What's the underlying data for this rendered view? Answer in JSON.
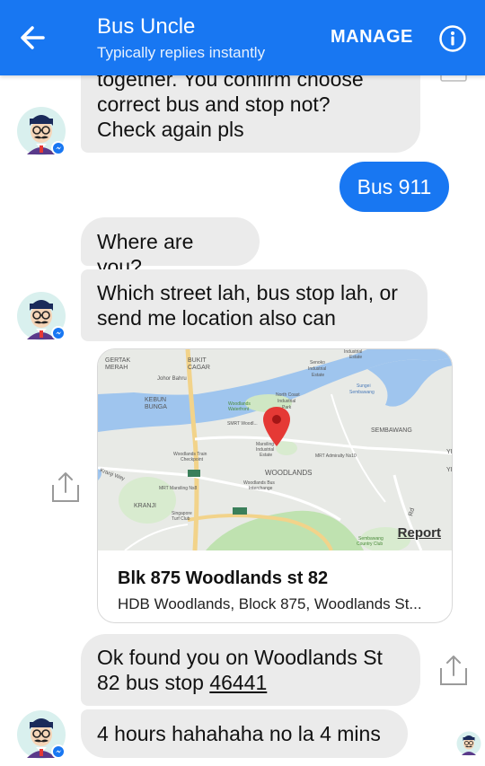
{
  "header": {
    "title": "Bus Uncle",
    "subtitle": "Typically replies instantly",
    "manage_label": "MANAGE"
  },
  "messages": [
    {
      "from": "bot",
      "lines": [
        "together. You confirm choose",
        "correct bus and stop not?",
        "Check again pls"
      ]
    },
    {
      "from": "user",
      "text": "Bus 911"
    },
    {
      "from": "bot",
      "lines": [
        "Where are you?"
      ]
    },
    {
      "from": "bot",
      "lines": [
        "Which street lah, bus stop lah, or",
        "send me location also can"
      ]
    },
    {
      "from": "bot",
      "type": "location",
      "place_name": "Blk 875 Woodlands st 82",
      "place_address": "HDB Woodlands, Block 875, Woodlands St...",
      "report_label": "Report"
    },
    {
      "from": "bot",
      "lines": [
        "Ok found you on Woodlands St",
        "82 bus stop "
      ],
      "link_text": "46441"
    },
    {
      "from": "bot",
      "lines": [
        "4 hours hahahaha no la 4 mins"
      ]
    }
  ],
  "map_labels": {
    "gertak_merah": "GERTAK\nMERAH",
    "bukit_cagar": "BUKIT\nCAGAR",
    "johor_bahru": "Johor Bahru",
    "kebun_bunga": "KEBUN\nBUNGA",
    "woodlands_waterfront": "Woodlands\nWaterfront",
    "north_coast": "North Coast\nIndustrial\nPark",
    "senoko": "Senoko\nIndustrial\nEstate",
    "sungei_sembawang": "Sungei\nSembawang",
    "smrt_woodlands": "SMRT Woodl...",
    "sembawang": "SEMBAWANG",
    "marsiling": "Marsiling\nIndustrial\nEstate",
    "woodlands_checkpoint": "Woodlands Train\nCheckpoint",
    "mrt_admiralty": "MRT Admiralty Ns10",
    "woodlands": "WOODLANDS",
    "woodlands_bus": "Woodlands Bus\nInterchange",
    "mrt_marsiling": "MRT Marsiling Ns8",
    "kranji": "KRANJI",
    "kranji_way": "Kranji Way",
    "singapore_turf": "Singapore\nTurf Club",
    "sembawang_country": "Sembawang\nCountry Club",
    "industrial_estate": "Industrial\nEstate",
    "road_number": "2",
    "bke": "BKE"
  },
  "colors": {
    "header_bg": "#1877f2",
    "user_bubble": "#1877f2",
    "bot_bubble": "#ebebeb",
    "pin": "#e53935"
  }
}
